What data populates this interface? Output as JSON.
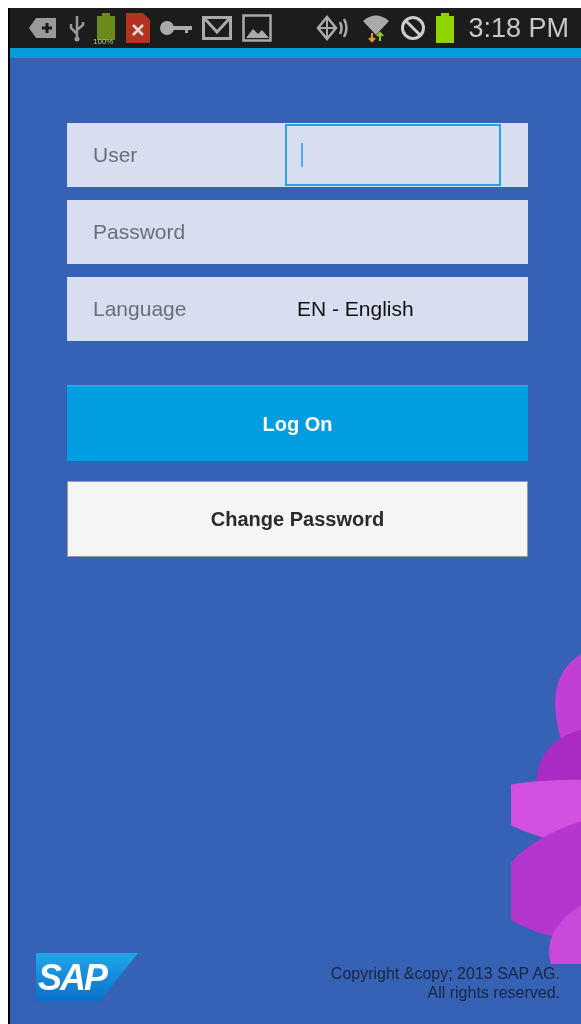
{
  "status_bar": {
    "battery_label": "100%",
    "time": "3:18 PM"
  },
  "fields": [
    {
      "kind": "input",
      "label": "User",
      "focused": true
    },
    {
      "kind": "input",
      "label": "Password"
    },
    {
      "kind": "select",
      "label": "Language",
      "value": "EN - English"
    }
  ],
  "buttons": [
    {
      "kind": "primary",
      "label": "Log On"
    },
    {
      "kind": "secondary",
      "label": "Change Password"
    }
  ],
  "footer": {
    "logo": "SAP",
    "copyright": [
      "Copyright &copy; 2013 SAP AG.",
      "All rights reserved."
    ]
  }
}
